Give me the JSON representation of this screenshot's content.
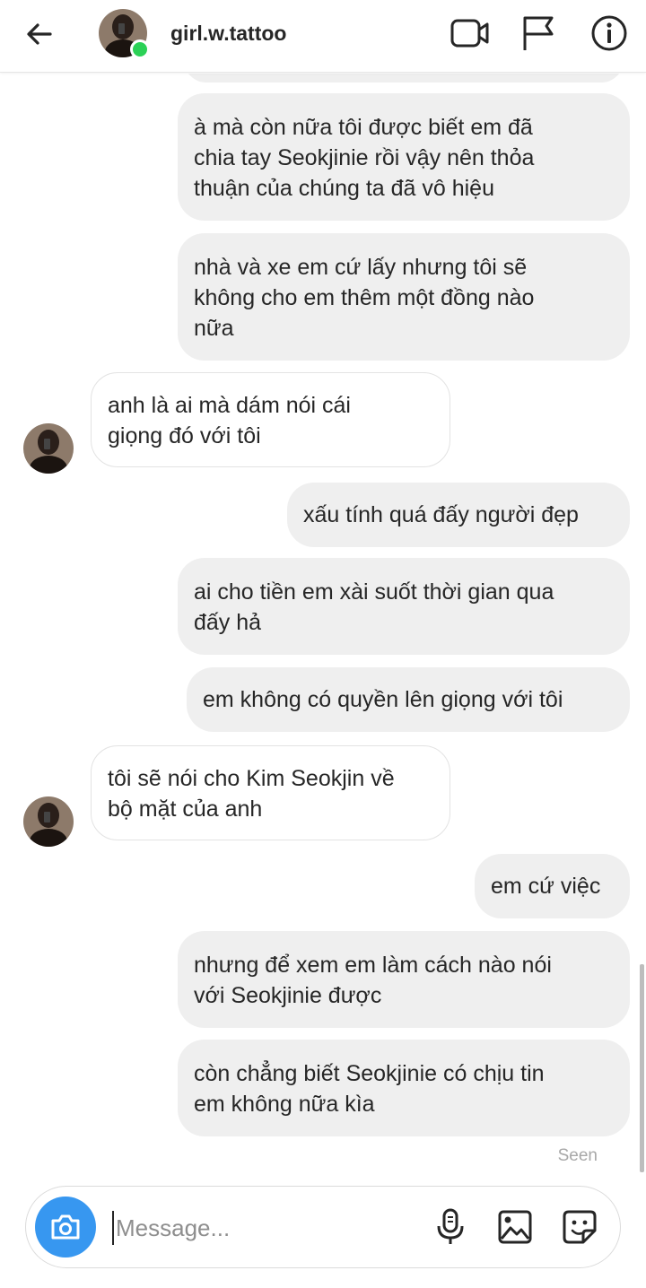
{
  "header": {
    "username": "girl.w.tattoo",
    "icons": [
      "back-arrow-icon",
      "video-call-icon",
      "flag-icon",
      "info-icon"
    ]
  },
  "messages": [
    {
      "side": "out",
      "lines": [
        "à mà còn nữa tôi được biết em đã",
        "chia tay Seokjinie rồi vậy nên thỏa",
        "thuận của chúng ta đã vô hiệu"
      ]
    },
    {
      "side": "out",
      "lines": [
        "nhà và xe em cứ lấy nhưng tôi sẽ",
        "không cho em thêm một đồng nào",
        "nữa"
      ]
    },
    {
      "side": "in",
      "lines": [
        "anh là ai mà dám nói cái",
        "giọng đó với tôi"
      ]
    },
    {
      "side": "out",
      "lines": [
        "xấu tính quá đấy người đẹp"
      ]
    },
    {
      "side": "out",
      "lines": [
        "ai cho tiền em xài suốt thời gian qua",
        "đấy hả"
      ]
    },
    {
      "side": "out",
      "lines": [
        "em không có quyền lên giọng với tôi"
      ]
    },
    {
      "side": "in",
      "lines": [
        "tôi sẽ nói cho Kim Seokjin về",
        "bộ mặt của anh"
      ]
    },
    {
      "side": "out",
      "lines": [
        "em cứ việc"
      ]
    },
    {
      "side": "out",
      "lines": [
        "nhưng để xem em làm cách nào nói",
        "với Seokjinie được"
      ]
    },
    {
      "side": "out",
      "lines": [
        "còn chẳng biết Seokjinie có chịu tin",
        "em không nữa kìa"
      ]
    }
  ],
  "seen_label": "Seen",
  "composer": {
    "placeholder": "Message...",
    "icons": [
      "camera-icon",
      "microphone-icon",
      "gallery-icon",
      "sticker-icon"
    ]
  },
  "colors": {
    "outgoing_bubble": "#efefef",
    "incoming_border": "#e3e3e3",
    "camera_button": "#3797f0",
    "online_dot": "#2bd156"
  }
}
